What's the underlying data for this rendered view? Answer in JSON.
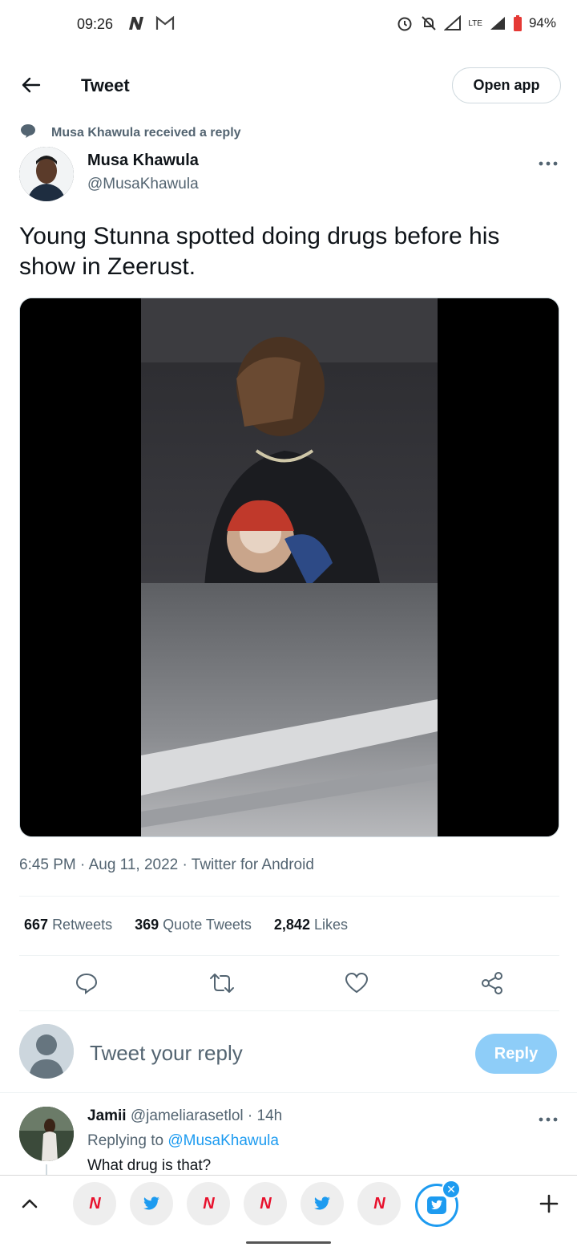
{
  "status_bar": {
    "time": "09:26",
    "battery": "94%",
    "network": "LTE",
    "icons": [
      "n-app-icon",
      "gmail-icon",
      "alarm-icon",
      "mute-icon",
      "signal-icon",
      "battery-icon"
    ]
  },
  "header": {
    "title": "Tweet",
    "open_app_label": "Open app"
  },
  "context": {
    "text": "Musa Khawula received a reply"
  },
  "tweet": {
    "author_name": "Musa Khawula",
    "author_handle": "@MusaKhawula",
    "text": "Young Stunna spotted doing drugs before his show in Zeerust.",
    "meta": "6:45 PM · Aug 11, 2022 · Twitter for Android",
    "stats": {
      "retweets_count": "667",
      "retweets_label": "Retweets",
      "quotes_count": "369",
      "quotes_label": "Quote Tweets",
      "likes_count": "2,842",
      "likes_label": "Likes"
    }
  },
  "composer": {
    "placeholder": "Tweet your reply",
    "reply_label": "Reply"
  },
  "reply": {
    "name": "Jamii",
    "handle": "@jameliarasetlol",
    "time": "· 14h",
    "replying_prefix": "Replying to",
    "replying_mention": "@MusaKhawula",
    "text": "What drug is that?"
  },
  "tab_bar": {
    "tabs": [
      "n-news",
      "twitter",
      "n-news",
      "n-news",
      "twitter",
      "n-news",
      "twitter-active"
    ]
  },
  "colors": {
    "accent": "#1d9bf0",
    "secondary_text": "#536471",
    "reply_button_disabled": "#8ecdf8"
  }
}
